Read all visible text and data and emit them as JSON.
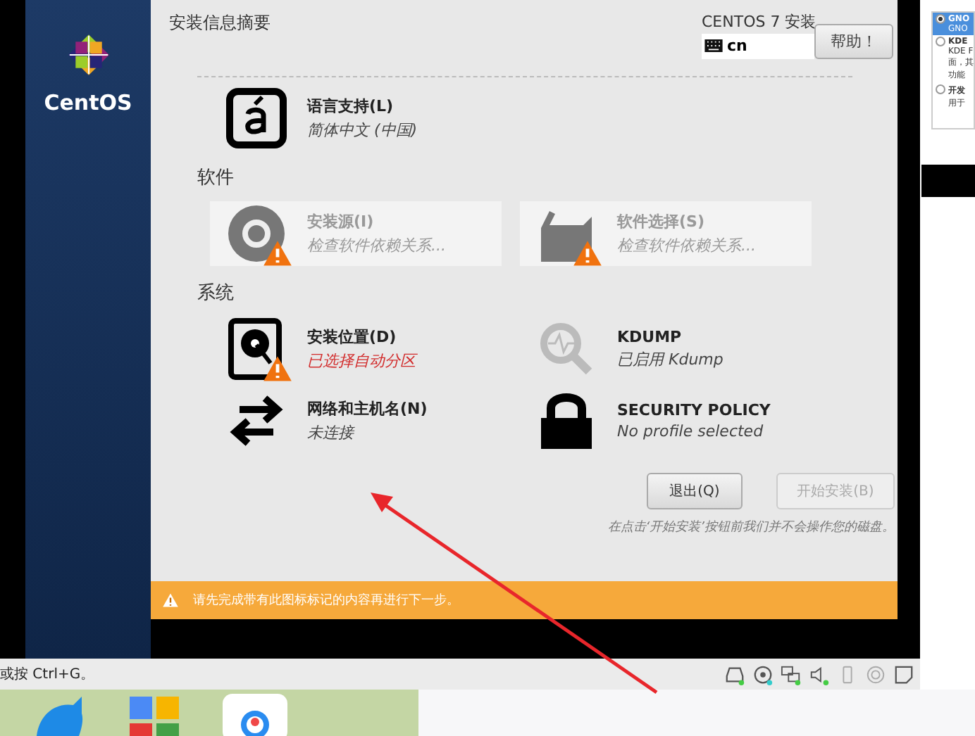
{
  "sidebar": {
    "logo_text": "CentOS"
  },
  "header": {
    "title": "安装信息摘要",
    "product": "CENTOS 7 安装",
    "keyboard_layout": "cn",
    "help_button": "帮助！"
  },
  "sections": [
    {
      "spokes": [
        {
          "kind": "language",
          "title": "语言支持(L)",
          "status": "简体中文 (中国)",
          "error": false,
          "warning": false,
          "disabled": false
        }
      ]
    },
    {
      "heading": "软件",
      "spokes": [
        {
          "kind": "disc",
          "title": "安装源(I)",
          "status": "检查软件依赖关系...",
          "error": false,
          "warning": true,
          "disabled": true
        },
        {
          "kind": "package",
          "title": "软件选择(S)",
          "status": "检查软件依赖关系...",
          "error": false,
          "warning": true,
          "disabled": true
        }
      ]
    },
    {
      "heading": "系统",
      "spokes": [
        {
          "kind": "disk",
          "title": "安装位置(D)",
          "status": "已选择自动分区",
          "error": true,
          "warning": true,
          "disabled": false
        },
        {
          "kind": "kdump",
          "title": "KDUMP",
          "status": "已启用 Kdump",
          "error": false,
          "warning": false,
          "disabled": false
        },
        {
          "kind": "network",
          "title": "网络和主机名(N)",
          "status": "未连接",
          "error": false,
          "warning": false,
          "disabled": false
        },
        {
          "kind": "lock",
          "title": "SECURITY POLICY",
          "status": "No profile selected",
          "error": false,
          "warning": false,
          "disabled": false
        }
      ]
    }
  ],
  "buttons": [
    {
      "label": "退出(Q)",
      "disabled": false
    },
    {
      "label": "开始安装(B)",
      "disabled": true
    }
  ],
  "note": "在点击‘开始安装’按钮前我们并不会操作您的磁盘。",
  "warning_bar": "请先完成带有此图标标记的内容再进行下一步。",
  "background_window": {
    "options": [
      {
        "title": "GNO",
        "lines": [
          "GNO"
        ],
        "selected": true
      },
      {
        "title": "KDE",
        "lines": [
          "KDE F",
          "面，其",
          "功能"
        ],
        "selected": false
      },
      {
        "title": "开发",
        "lines": [
          "用于"
        ],
        "selected": false
      }
    ]
  },
  "vm_status_bar": {
    "hint": "或按 Ctrl+G。"
  }
}
